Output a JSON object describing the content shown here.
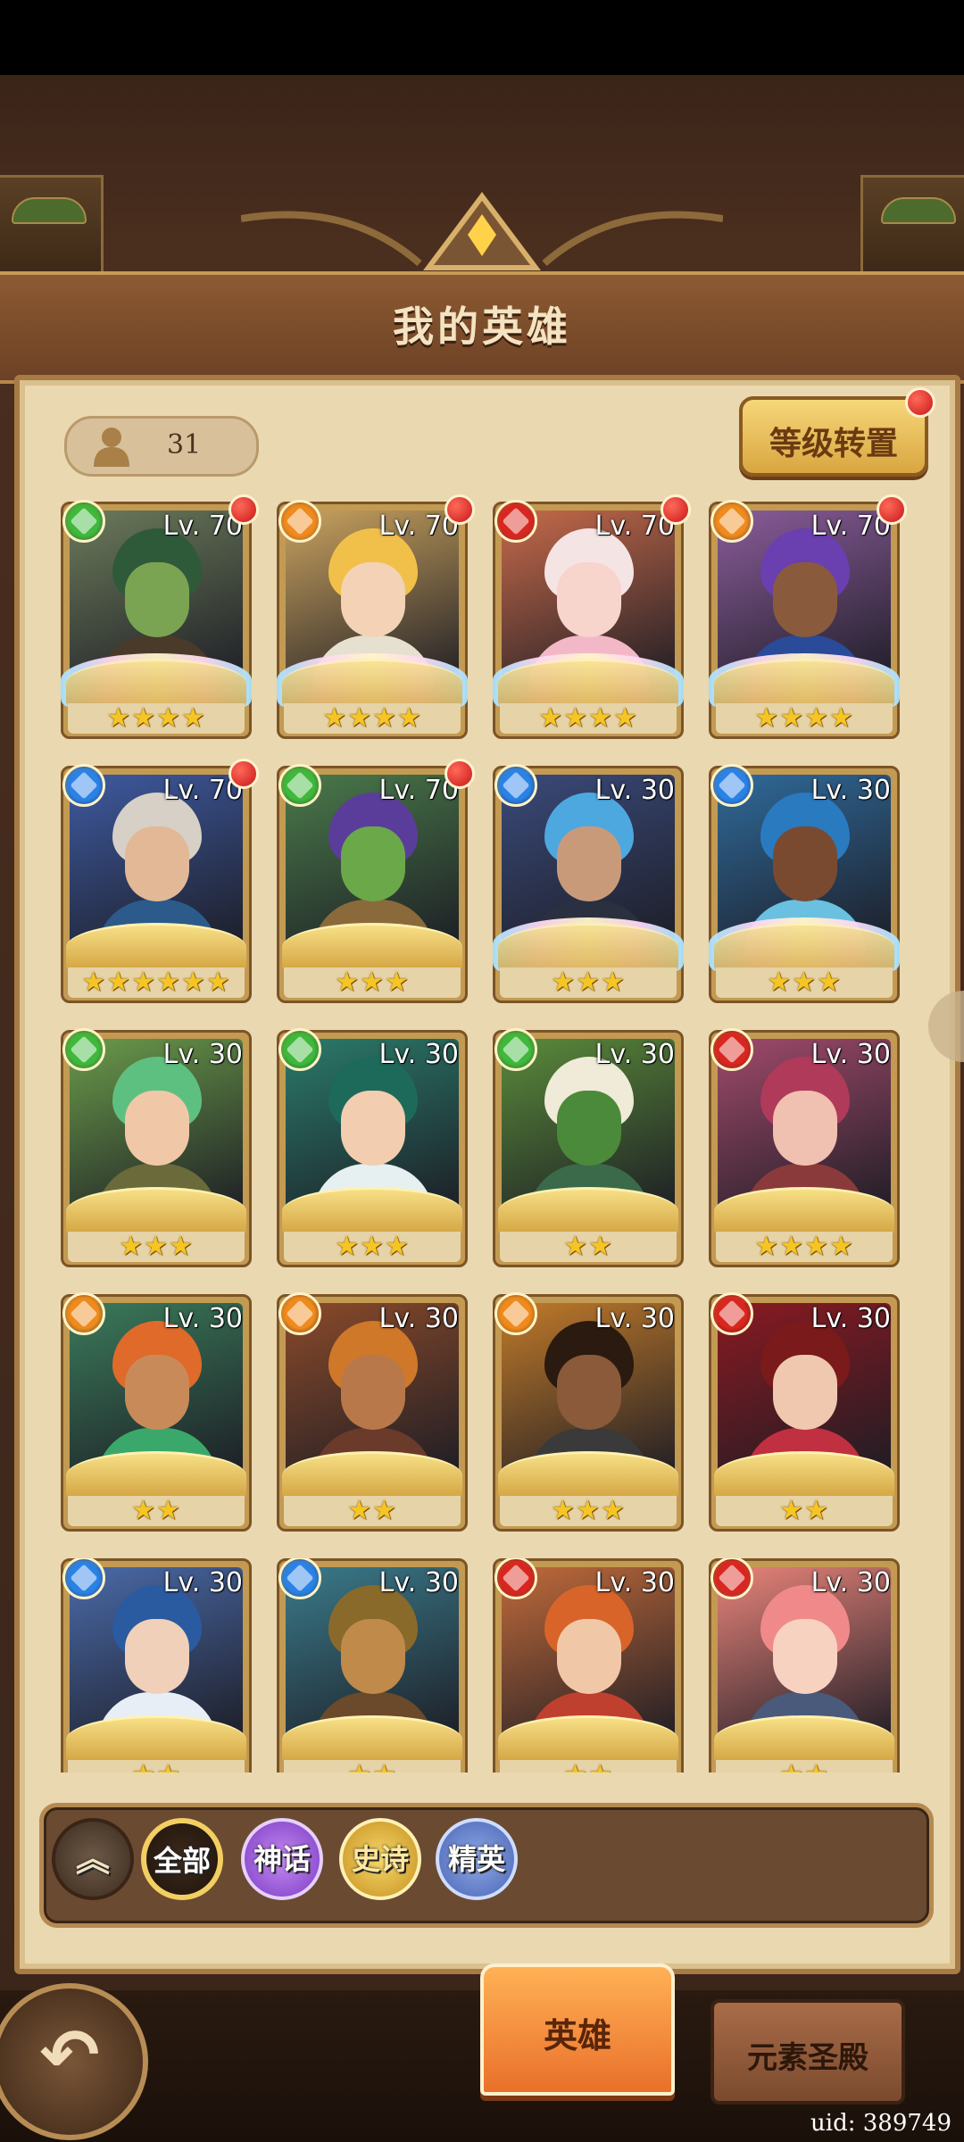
{
  "header": {
    "title": "我的英雄"
  },
  "counter": {
    "value": "31",
    "icon": "person-icon"
  },
  "level_transfer": {
    "label": "等级转置"
  },
  "colors": {
    "element_wind": "#3fb83b",
    "element_earth": "#f08a1c",
    "element_fire": "#d9261e",
    "element_water": "#2a82e6",
    "star": "#f5c623"
  },
  "heroes": [
    {
      "level": "Lv. 70",
      "element": "wind",
      "stars": "★★★★",
      "red_dot": true,
      "wings": true,
      "hair": "#2f5a3a",
      "skin": "#7aa452",
      "bg": "#6b7a5a",
      "cloth": "#4a3a2a"
    },
    {
      "level": "Lv. 70",
      "element": "earth",
      "stars": "★★★★",
      "red_dot": true,
      "wings": true,
      "hair": "#f1c04a",
      "skin": "#f3d2b6",
      "bg": "#c9a25e",
      "cloth": "#e6e0d0"
    },
    {
      "level": "Lv. 70",
      "element": "fire",
      "stars": "★★★★",
      "red_dot": true,
      "wings": true,
      "hair": "#f5e4e4",
      "skin": "#f7d4cc",
      "bg": "#c66a4a",
      "cloth": "#f3b8c8"
    },
    {
      "level": "Lv. 70",
      "element": "earth",
      "stars": "★★★★",
      "red_dot": true,
      "wings": true,
      "hair": "#6a3fb0",
      "skin": "#8a5a3c",
      "bg": "#8a5c9a",
      "cloth": "#2a4a9a"
    },
    {
      "level": "Lv. 70",
      "element": "water",
      "stars": "★★★★★★",
      "red_dot": true,
      "wings": false,
      "hair": "#d6d0c6",
      "skin": "#e3b896",
      "bg": "#3e5aa0",
      "cloth": "#2c5a8a"
    },
    {
      "level": "Lv. 70",
      "element": "wind",
      "stars": "★★★",
      "red_dot": true,
      "wings": false,
      "hair": "#5a3d9a",
      "skin": "#6aa84a",
      "bg": "#4a7a4a",
      "cloth": "#8a6a3a"
    },
    {
      "level": "Lv. 30",
      "element": "water",
      "stars": "★★★",
      "red_dot": false,
      "wings": true,
      "hair": "#4ea8e0",
      "skin": "#c99a7a",
      "bg": "#3a4a7a",
      "cloth": "#2a3040"
    },
    {
      "level": "Lv. 30",
      "element": "water",
      "stars": "★★★",
      "red_dot": false,
      "wings": true,
      "hair": "#2a7ac0",
      "skin": "#7a4a30",
      "bg": "#2f6a9a",
      "cloth": "#6ac0e0"
    },
    {
      "level": "Lv. 30",
      "element": "wind",
      "stars": "★★★",
      "red_dot": false,
      "wings": false,
      "hair": "#5ec080",
      "skin": "#f0c8a8",
      "bg": "#6a9a4a",
      "cloth": "#6a6a3a"
    },
    {
      "level": "Lv. 30",
      "element": "wind",
      "stars": "★★★",
      "red_dot": false,
      "wings": false,
      "hair": "#1e6a5a",
      "skin": "#f3cdb0",
      "bg": "#2a7a6a",
      "cloth": "#e6f0f0"
    },
    {
      "level": "Lv. 30",
      "element": "wind",
      "stars": "★★",
      "red_dot": false,
      "wings": false,
      "hair": "#f0ead8",
      "skin": "#4a8a3a",
      "bg": "#5a8a3a",
      "cloth": "#3a6a4a"
    },
    {
      "level": "Lv. 30",
      "element": "fire",
      "stars": "★★★★",
      "red_dot": false,
      "wings": false,
      "hair": "#b03a5a",
      "skin": "#f0c0b0",
      "bg": "#a04a6a",
      "cloth": "#8a3a3a"
    },
    {
      "level": "Lv. 30",
      "element": "earth",
      "stars": "★★",
      "red_dot": false,
      "wings": false,
      "hair": "#e06a2a",
      "skin": "#c98a5a",
      "bg": "#3a7a5a",
      "cloth": "#3aa86a"
    },
    {
      "level": "Lv. 30",
      "element": "earth",
      "stars": "★★",
      "red_dot": false,
      "wings": false,
      "hair": "#d0782a",
      "skin": "#b8784a",
      "bg": "#8a4a2a",
      "cloth": "#6a3a2a"
    },
    {
      "level": "Lv. 30",
      "element": "earth",
      "stars": "★★★",
      "red_dot": false,
      "wings": false,
      "hair": "#2a1a10",
      "skin": "#8a5a3a",
      "bg": "#c07a2a",
      "cloth": "#3a3a3a"
    },
    {
      "level": "Lv. 30",
      "element": "fire",
      "stars": "★★",
      "red_dot": false,
      "wings": false,
      "hair": "#7a1a1a",
      "skin": "#f0c8b0",
      "bg": "#8a1a22",
      "cloth": "#c03040"
    },
    {
      "level": "Lv. 30",
      "element": "water",
      "stars": "★★",
      "red_dot": false,
      "wings": false,
      "hair": "#2a5aa0",
      "skin": "#f0d0b8",
      "bg": "#4a6aa8",
      "cloth": "#e8eef6"
    },
    {
      "level": "Lv. 30",
      "element": "water",
      "stars": "★★",
      "red_dot": false,
      "wings": false,
      "hair": "#8a6a2a",
      "skin": "#c08a4a",
      "bg": "#3a7a8a",
      "cloth": "#6a4a2a"
    },
    {
      "level": "Lv. 30",
      "element": "fire",
      "stars": "★★",
      "red_dot": false,
      "wings": false,
      "hair": "#d8642a",
      "skin": "#f0c8a8",
      "bg": "#c06a3a",
      "cloth": "#c04030"
    },
    {
      "level": "Lv. 30",
      "element": "fire",
      "stars": "★★",
      "red_dot": false,
      "wings": false,
      "hair": "#f08a8a",
      "skin": "#f7d2c0",
      "bg": "#e8847a",
      "cloth": "#4a5a7a"
    }
  ],
  "filters": {
    "collapse_icon": "double-chevron-up-icon",
    "collapse_glyph": "︽",
    "all": "全部",
    "myth": "神话",
    "epic": "史诗",
    "elite": "精英"
  },
  "nav": {
    "back_icon": "back-arrow-icon",
    "back_glyph": "↶",
    "hero_tab": "英雄",
    "temple_tab": "元素圣殿"
  },
  "uid": "uid: 389749"
}
